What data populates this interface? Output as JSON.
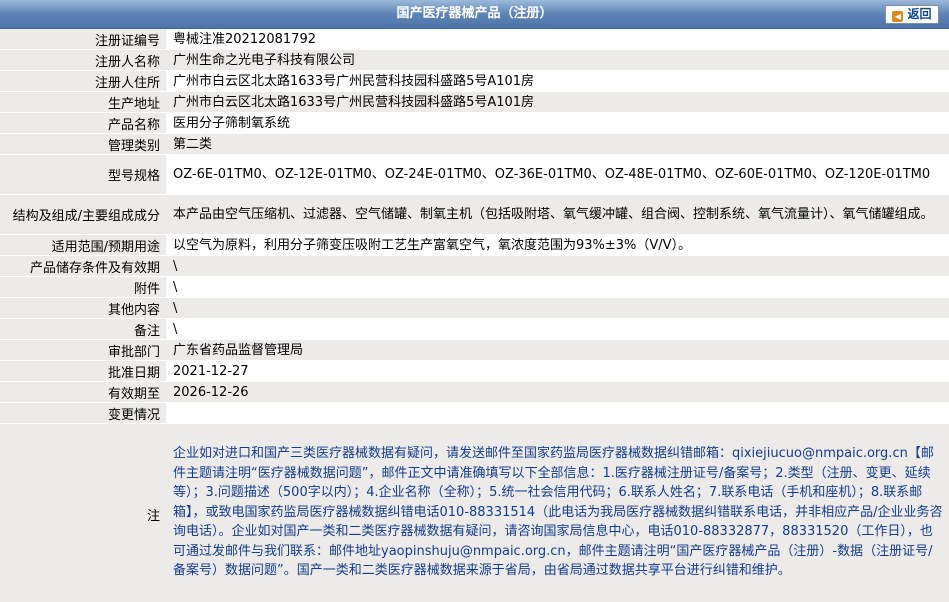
{
  "header": {
    "title": "国产医疗器械产品（注册）",
    "back_label": "返回"
  },
  "fields": [
    {
      "label": "注册证编号",
      "value": "粤械注准20212081792"
    },
    {
      "label": "注册人名称",
      "value": "广州生命之光电子科技有限公司"
    },
    {
      "label": "注册人住所",
      "value": "广州市白云区北太路1633号广州民营科技园科盛路5号A101房"
    },
    {
      "label": "生产地址",
      "value": "广州市白云区北太路1633号广州民营科技园科盛路5号A101房"
    },
    {
      "label": "产品名称",
      "value": "医用分子筛制氧系统"
    },
    {
      "label": "管理类别",
      "value": "第二类"
    },
    {
      "label": "型号规格",
      "value": "OZ-6E-01TM0、OZ-12E-01TM0、OZ-24E-01TM0、OZ-36E-01TM0、OZ-48E-01TM0、OZ-60E-01TM0、OZ-120E-01TM0"
    },
    {
      "label": "结构及组成/主要组成成分",
      "value": "本产品由空气压缩机、过滤器、空气储罐、制氧主机（包括吸附塔、氧气缓冲罐、组合阀、控制系统、氧气流量计）、氧气储罐组成。"
    },
    {
      "label": "适用范围/预期用途",
      "value": "以空气为原料，利用分子筛变压吸附工艺生产富氧空气，氧浓度范围为93%±3%（V/V）。"
    },
    {
      "label": "产品储存条件及有效期",
      "value": "\\"
    },
    {
      "label": "附件",
      "value": "\\"
    },
    {
      "label": "其他内容",
      "value": "\\"
    },
    {
      "label": "备注",
      "value": "\\"
    },
    {
      "label": "审批部门",
      "value": "广东省药品监督管理局"
    },
    {
      "label": "批准日期",
      "value": "2021-12-27"
    },
    {
      "label": "有效期至",
      "value": "2026-12-26"
    },
    {
      "label": "变更情况",
      "value": ""
    }
  ],
  "note": {
    "label": "注",
    "text": "企业如对进口和国产三类医疗器械数据有疑问，请发送邮件至国家药监局医疗器械数据纠错邮箱：qixiejiucuo@nmpaic.org.cn【邮件主题请注明“医疗器械数据问题”，邮件正文中请准确填写以下全部信息：1.医疗器械注册证号/备案号；2.类型（注册、变更、延续等）；3.问题描述（500字以内）；4.企业名称（全称）；5.统一社会信用代码；6.联系人姓名；7.联系电话（手机和座机）；8.联系邮箱】，或致电国家药监局医疗器械数据纠错电话010-88331514（此电话为我局医疗器械数据纠错联系电话，并非相应产品/企业业务咨询电话）。企业如对国产一类和二类医疗器械数据有疑问，请咨询国家局信息中心，电话010-88332877，88331520（工作日），也可通过发邮件与我们联系：邮件地址yaopinshuju@nmpaic.org.cn，邮件主题请注明“国产医疗器械产品（注册）-数据（注册证号/备案号）数据问题”。国产一类和二类医疗器械数据来源于省局，由省局通过数据共享平台进行纠错和维护。"
  }
}
